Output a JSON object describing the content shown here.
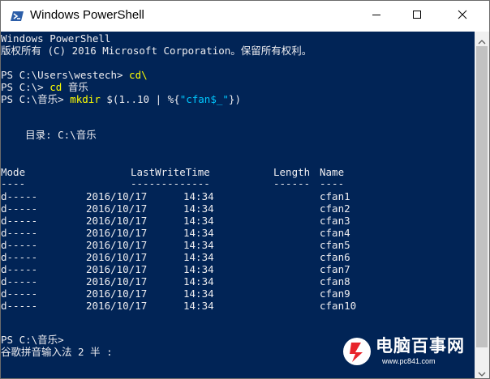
{
  "window": {
    "title": "Windows PowerShell"
  },
  "console": {
    "header": [
      "Windows PowerShell",
      "版权所有 (C) 2016 Microsoft Corporation。保留所有权利。"
    ],
    "prompt1": "PS C:\\Users\\westech>",
    "cmd1": "cd\\",
    "prompt2": "PS C:\\>",
    "cmd2_name": "cd",
    "cmd2_arg": "音乐",
    "prompt3": "PS C:\\音乐>",
    "cmd3_name": "mkdir",
    "cmd3_pre": "$(1..10 | %{",
    "cmd3_str": "\"cfan$_\"",
    "cmd3_post": "})",
    "directory": "    目录: C:\\音乐",
    "table": {
      "headers": [
        "Mode",
        "LastWriteTime",
        "Length",
        "Name"
      ],
      "underlines": [
        "----",
        "-------------",
        "------",
        "----"
      ],
      "rows": [
        {
          "mode": "d-----",
          "date": "2016/10/17",
          "time": "14:34",
          "name": "cfan1"
        },
        {
          "mode": "d-----",
          "date": "2016/10/17",
          "time": "14:34",
          "name": "cfan2"
        },
        {
          "mode": "d-----",
          "date": "2016/10/17",
          "time": "14:34",
          "name": "cfan3"
        },
        {
          "mode": "d-----",
          "date": "2016/10/17",
          "time": "14:34",
          "name": "cfan4"
        },
        {
          "mode": "d-----",
          "date": "2016/10/17",
          "time": "14:34",
          "name": "cfan5"
        },
        {
          "mode": "d-----",
          "date": "2016/10/17",
          "time": "14:34",
          "name": "cfan6"
        },
        {
          "mode": "d-----",
          "date": "2016/10/17",
          "time": "14:34",
          "name": "cfan7"
        },
        {
          "mode": "d-----",
          "date": "2016/10/17",
          "time": "14:34",
          "name": "cfan8"
        },
        {
          "mode": "d-----",
          "date": "2016/10/17",
          "time": "14:34",
          "name": "cfan9"
        },
        {
          "mode": "d-----",
          "date": "2016/10/17",
          "time": "14:34",
          "name": "cfan10"
        }
      ]
    },
    "prompt4": "PS C:\\音乐>",
    "ime_status": "谷歌拼音输入法 2 半 :"
  },
  "watermark": {
    "brand": "电脑百事网",
    "url": "www.pc841.com"
  },
  "colors": {
    "console_bg": "#012456",
    "console_text": "#eeedf0",
    "command_color": "#ffff00",
    "string_color": "#00c8ff",
    "brand_red": "#e8242b"
  },
  "icons": {
    "app": "powershell-icon",
    "minimize": "minimize-icon",
    "maximize": "maximize-icon",
    "close": "close-icon"
  }
}
